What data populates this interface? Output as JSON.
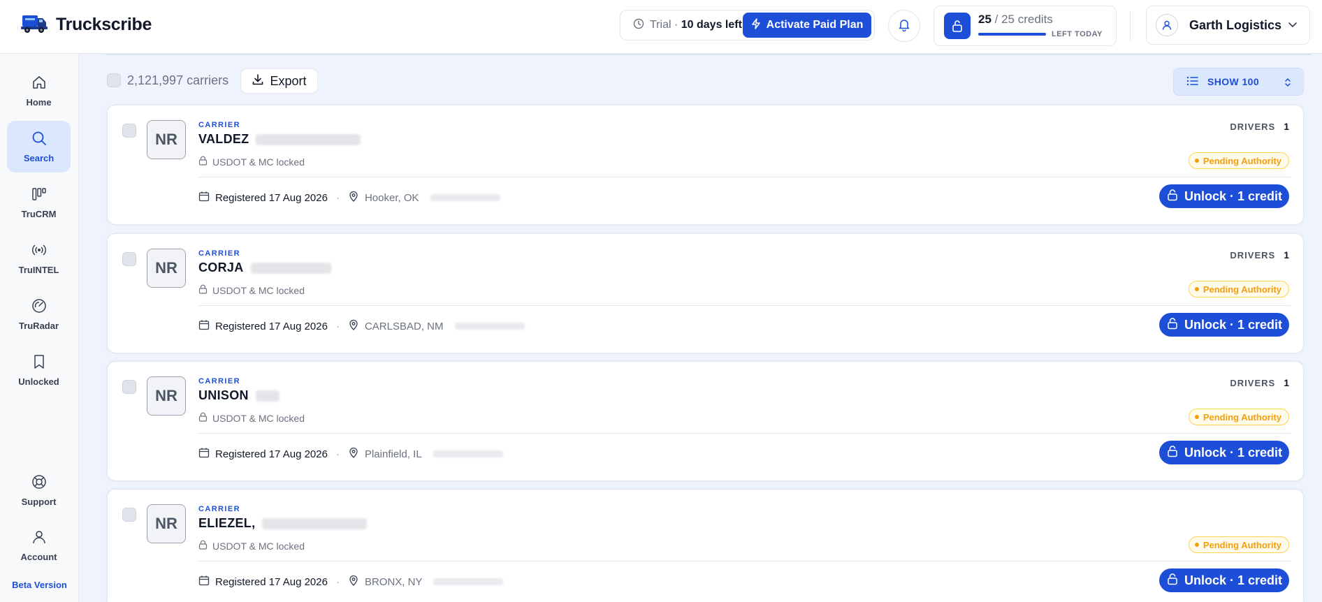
{
  "app": {
    "name": "Truckscribe"
  },
  "header": {
    "trial_label": "Trial",
    "trial_sep": "·",
    "trial_days": "10 days left",
    "activate_label": "Activate Paid Plan",
    "credits_used": "25",
    "credits_total": "/ 25 credits",
    "credits_sub": "LEFT TODAY",
    "credits_fraction": 1.0,
    "account_name": "Garth Logistics"
  },
  "sidebar": {
    "items": [
      {
        "label": "Home",
        "icon": "home-icon"
      },
      {
        "label": "Search",
        "icon": "search-icon",
        "active": true
      },
      {
        "label": "TruCRM",
        "icon": "crm-icon"
      },
      {
        "label": "TruINTEL",
        "icon": "signal-icon"
      },
      {
        "label": "TruRadar",
        "icon": "radar-icon"
      },
      {
        "label": "Unlocked",
        "icon": "bookmark-icon"
      }
    ],
    "bottom": [
      {
        "label": "Support",
        "icon": "lifebuoy-icon"
      },
      {
        "label": "Account",
        "icon": "user-icon"
      }
    ],
    "beta": "Beta Version"
  },
  "toolbar": {
    "count": "2,121,997 carriers",
    "export_label": "Export",
    "show_label": "SHOW 100"
  },
  "cards": [
    {
      "initials": "NR",
      "type": "CARRIER",
      "name": "VALDEZ",
      "locked": "USDOT & MC locked",
      "registered": "Registered 17 Aug 2026",
      "location": "Hooker, OK",
      "drivers_label": "DRIVERS",
      "drivers": "1",
      "status": "Pending Authority",
      "unlock": "Unlock · 1 credit"
    },
    {
      "initials": "NR",
      "type": "CARRIER",
      "name": "CORJA",
      "locked": "USDOT & MC locked",
      "registered": "Registered 17 Aug 2026",
      "location": "CARLSBAD, NM",
      "drivers_label": "DRIVERS",
      "drivers": "1",
      "status": "Pending Authority",
      "unlock": "Unlock · 1 credit"
    },
    {
      "initials": "NR",
      "type": "CARRIER",
      "name": "UNISON",
      "locked": "USDOT & MC locked",
      "registered": "Registered 17 Aug 2026",
      "location": "Plainfield, IL",
      "drivers_label": "DRIVERS",
      "drivers": "1",
      "status": "Pending Authority",
      "unlock": "Unlock · 1 credit"
    },
    {
      "initials": "NR",
      "type": "CARRIER",
      "name": "ELIEZEL,",
      "locked": "USDOT & MC locked",
      "registered": "Registered 17 Aug 2026",
      "location": "BRONX, NY",
      "status": "Pending Authority",
      "unlock": "Unlock · 1 credit"
    }
  ],
  "colors": {
    "accent": "#1d4ed8",
    "background": "#eef3fd",
    "pending": "#f59e0b"
  }
}
